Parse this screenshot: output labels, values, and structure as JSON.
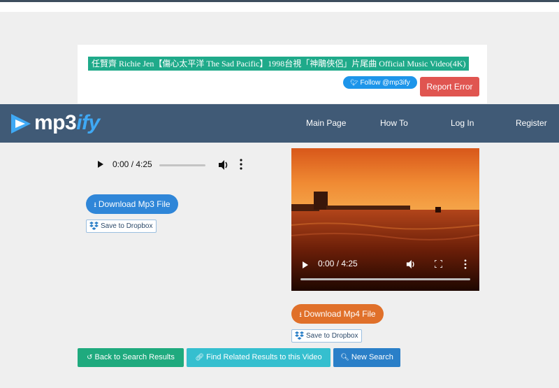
{
  "video": {
    "title": "任賢齊 Richie Jen【傷心太平洋 The Sad Pacific】1998台視「神鵰俠侶」片尾曲 Official Music Video(4K)"
  },
  "header": {
    "follow_label": "Follow @mp3ify",
    "report_label": "Report Error"
  },
  "brand": {
    "name_part1": "mp3",
    "name_part2": "ify",
    "accent_color": "#3fa9f5",
    "navbar_color": "#405a76"
  },
  "nav": {
    "items": [
      {
        "label": "Main Page"
      },
      {
        "label": "How To"
      },
      {
        "label": "Log In"
      },
      {
        "label": "Register"
      }
    ]
  },
  "audio_player": {
    "time": "0:00 / 4:25",
    "progress": 0
  },
  "video_player": {
    "time": "0:00 / 4:25",
    "progress": 0
  },
  "downloads": {
    "mp3_label": "Download Mp3 File",
    "mp4_label": "Download Mp4 File",
    "dropbox_label": "Save to Dropbox",
    "mp3_color": "#2f86d8",
    "mp4_color": "#e0702a"
  },
  "actions": {
    "back_label": "Back to Search Results",
    "related_label": "Find Related Results to this Video",
    "new_search_label": "New Search"
  }
}
